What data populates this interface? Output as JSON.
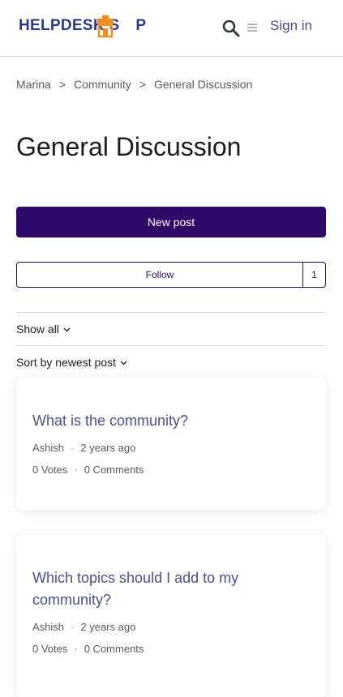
{
  "header": {
    "logo_text_left": "HELPDESK S",
    "logo_text_right": "P",
    "signin_label": "Sign in",
    "icons": [
      "search-icon",
      "menu-icon",
      "store-icon"
    ]
  },
  "breadcrumb": {
    "items": [
      "Marina",
      "Community",
      "General Discussion"
    ],
    "separator": ">"
  },
  "page": {
    "title": "General Discussion"
  },
  "actions": {
    "new_post_label": "New post",
    "follow_label": "Follow",
    "follow_count": "1"
  },
  "filters": {
    "show_label": "Show all",
    "sort_label": "Sort by newest post"
  },
  "posts": [
    {
      "title": "What is the community?",
      "author": "Ashish",
      "time": "2 years ago",
      "votes": "0 Votes",
      "comments": "0 Comments"
    },
    {
      "title": "Which topics should I add to my community?",
      "author": "Ashish",
      "time": "2 years ago",
      "votes": "0 Votes",
      "comments": "0 Comments"
    }
  ],
  "colors": {
    "brand": "#2e0a6b",
    "logo": "#2d3a8c",
    "logo_accent": "#f28c1e",
    "link": "#4b4f8c"
  }
}
